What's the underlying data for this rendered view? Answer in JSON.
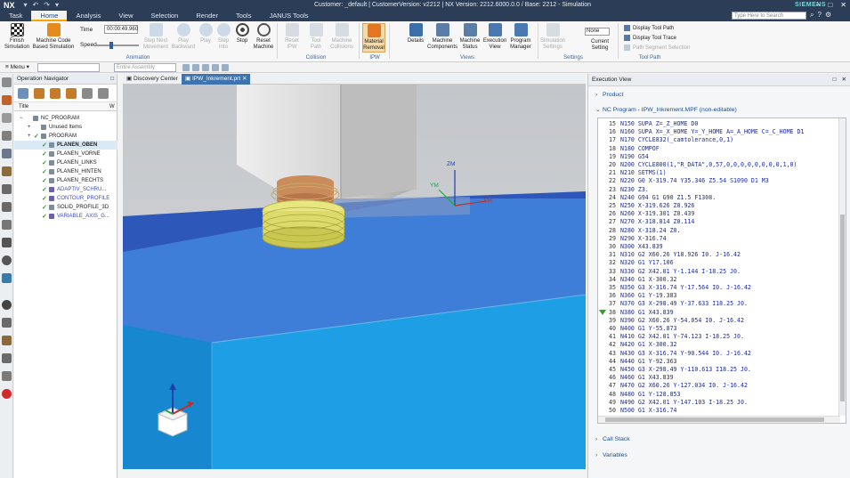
{
  "app": {
    "logo": "NX",
    "window_title": "Customer: _default | CustomerVersion: v2212 | NX Version: 2212.6000.0.0 / Base: 2212 - Simulation",
    "brand": "SIEMENS"
  },
  "tabs": [
    {
      "label": "Task"
    },
    {
      "label": "Home"
    },
    {
      "label": "Analysis"
    },
    {
      "label": "View"
    },
    {
      "label": "Selection"
    },
    {
      "label": "Render"
    },
    {
      "label": "Tools"
    },
    {
      "label": "JANUS Tools"
    }
  ],
  "active_tab": "Home",
  "search_placeholder": "Type Here to Search",
  "ribbon": {
    "finish": "Finish Simulation",
    "machine_code": "Machine Code Based Simulation",
    "time_label": "Time",
    "time_value": "00:00:49.960",
    "speed_label": "Speed",
    "speed_fraction": 0.35,
    "step_next": "Step Next Movement",
    "play_back": "Play Backward",
    "play": "Play",
    "step_into": "Step Into",
    "stop": "Stop",
    "reset": "Reset Machine",
    "reset_ipw": "Reset IPW",
    "tool_path": "Tool Path",
    "machine_collisions": "Machine Collisions",
    "material_removal": "Material Removal",
    "details": "Details",
    "machine_components": "Machine Components",
    "machine_status": "Machine Status",
    "execution_view": "Execution View",
    "program_manager": "Program Manager",
    "simulation_settings": "Simulation Settings",
    "current_setting": "Current Setting",
    "current_setting_value": "None",
    "display_tool_path": "Display Tool Path",
    "display_tool_trace": "Display Tool Trace",
    "path_segment_selection": "Path Segment Selection",
    "groups": {
      "animation": "Animation",
      "collision": "Collision",
      "ipw": "IPW",
      "views": "Views",
      "settings": "Settings",
      "toolpath": "Tool Path"
    }
  },
  "toolbar2": {
    "menu": "Menu",
    "assembly_placeholder": "Entire Assembly"
  },
  "navigator": {
    "title": "Operation Navigator",
    "col_title": "Title",
    "col_w": "W",
    "rows": [
      {
        "label": "NC_PROGRAM",
        "level": 0,
        "check": false,
        "bold": false,
        "blue": false
      },
      {
        "label": "Unused Items",
        "level": 1,
        "check": false,
        "bold": false,
        "blue": false
      },
      {
        "label": "PROGRAM",
        "level": 1,
        "check": true,
        "bold": false,
        "blue": false
      },
      {
        "label": "PLANEN_OBEN",
        "level": 2,
        "check": true,
        "bold": true,
        "blue": false
      },
      {
        "label": "PLANEN_VORNE",
        "level": 2,
        "check": true,
        "bold": false,
        "blue": false
      },
      {
        "label": "PLANEN_LINKS",
        "level": 2,
        "check": true,
        "bold": false,
        "blue": false
      },
      {
        "label": "PLANEN_HINTEN",
        "level": 2,
        "check": true,
        "bold": false,
        "blue": false
      },
      {
        "label": "PLANEN_RECHTS",
        "level": 2,
        "check": true,
        "bold": false,
        "blue": false
      },
      {
        "label": "ADAPTIV_SCHRU...",
        "level": 2,
        "check": true,
        "bold": false,
        "blue": true
      },
      {
        "label": "CONTOUR_PROFILE",
        "level": 2,
        "check": true,
        "bold": false,
        "blue": true
      },
      {
        "label": "SOLID_PROFILE_3D",
        "level": 2,
        "check": true,
        "bold": false,
        "blue": false
      },
      {
        "label": "VARIABLE_AXIS_G...",
        "level": 2,
        "check": true,
        "bold": false,
        "blue": true
      }
    ]
  },
  "doc_tabs": [
    "Discovery Center",
    "IPW_Inkrement.prt"
  ],
  "viewport": {
    "axis_z": "ZM",
    "axis_y": "YM",
    "axis_x": "XM"
  },
  "exec": {
    "title": "Execution View",
    "section_product": "Product",
    "section_program": "NC Program - IPW_Inkrement.MPF (non-editable)",
    "section_callstack": "Call Stack",
    "section_variables": "Variables",
    "current_line": 38,
    "lines": [
      {
        "n": "15",
        "t": "N150 SUPA Z=_Z_HOME D0"
      },
      {
        "n": "16",
        "t": "N160 SUPA X=_X_HOME Y=_Y_HOME A=_A_HOME C=_C_HOME D1"
      },
      {
        "n": "17",
        "t": "N170 CYCLE832(_camtolerance,0,1)"
      },
      {
        "n": "18",
        "t": "N180 COMPOF"
      },
      {
        "n": "19",
        "t": "N190 G54"
      },
      {
        "n": "20",
        "t": "N200 CYCLE800(1,\"R_DATA\",0,57,0,0,0,0,0,0,0,0,1,0)"
      },
      {
        "n": "21",
        "t": "N210 SETMS(1)"
      },
      {
        "n": "22",
        "t": "N220 G0 X-319.74 Y35.346 Z5.54 S1090 D1 M3"
      },
      {
        "n": "23",
        "t": "N230 Z3."
      },
      {
        "n": "24",
        "t": "N240 G94 G1 G90 Z1.5 F1308."
      },
      {
        "n": "25",
        "t": "N250 X-319.626 Z0.926"
      },
      {
        "n": "26",
        "t": "N260 X-319.301 Z0.439"
      },
      {
        "n": "27",
        "t": "N270 X-318.814 Z0.114"
      },
      {
        "n": "28",
        "t": "N280 X-318.24 Z0."
      },
      {
        "n": "29",
        "t": "N290 X-316.74"
      },
      {
        "n": "30",
        "t": "N300 X43.839"
      },
      {
        "n": "31",
        "t": "N310 G2 X60.26 Y18.926 I0. J-16.42"
      },
      {
        "n": "32",
        "t": "N320 G1 Y17.106"
      },
      {
        "n": "33",
        "t": "N330 G2 X42.01 Y-1.144 I-18.25 J0."
      },
      {
        "n": "34",
        "t": "N340 G1 X-300.32"
      },
      {
        "n": "35",
        "t": "N350 G3 X-316.74 Y-17.564 I0. J-16.42"
      },
      {
        "n": "36",
        "t": "N360 G1 Y-19.383"
      },
      {
        "n": "37",
        "t": "N370 G3 X-298.49 Y-37.633 I18.25 J0."
      },
      {
        "n": "38",
        "t": "N380 G1 X43.839"
      },
      {
        "n": "39",
        "t": "N390 G2 X60.26 Y-54.054 I0. J-16.42"
      },
      {
        "n": "40",
        "t": "N400 G1 Y-55.873"
      },
      {
        "n": "41",
        "t": "N410 G2 X42.01 Y-74.123 I-18.25 J0."
      },
      {
        "n": "42",
        "t": "N420 G1 X-300.32"
      },
      {
        "n": "43",
        "t": "N430 G3 X-316.74 Y-90.544 I0. J-16.42"
      },
      {
        "n": "44",
        "t": "N440 G1 Y-92.363"
      },
      {
        "n": "45",
        "t": "N450 G3 X-298.49 Y-110.613 I18.25 J0."
      },
      {
        "n": "46",
        "t": "N460 G1 X43.839"
      },
      {
        "n": "47",
        "t": "N470 G2 X60.26 Y-127.034 I0. J-16.42"
      },
      {
        "n": "48",
        "t": "N480 G1 Y-128.853"
      },
      {
        "n": "49",
        "t": "N490 G2 X42.01 Y-147.103 I-18.25 J0."
      },
      {
        "n": "50",
        "t": "N500 G1 X-316.74"
      },
      {
        "n": "51",
        "t": "N510 X-318.24"
      }
    ]
  }
}
